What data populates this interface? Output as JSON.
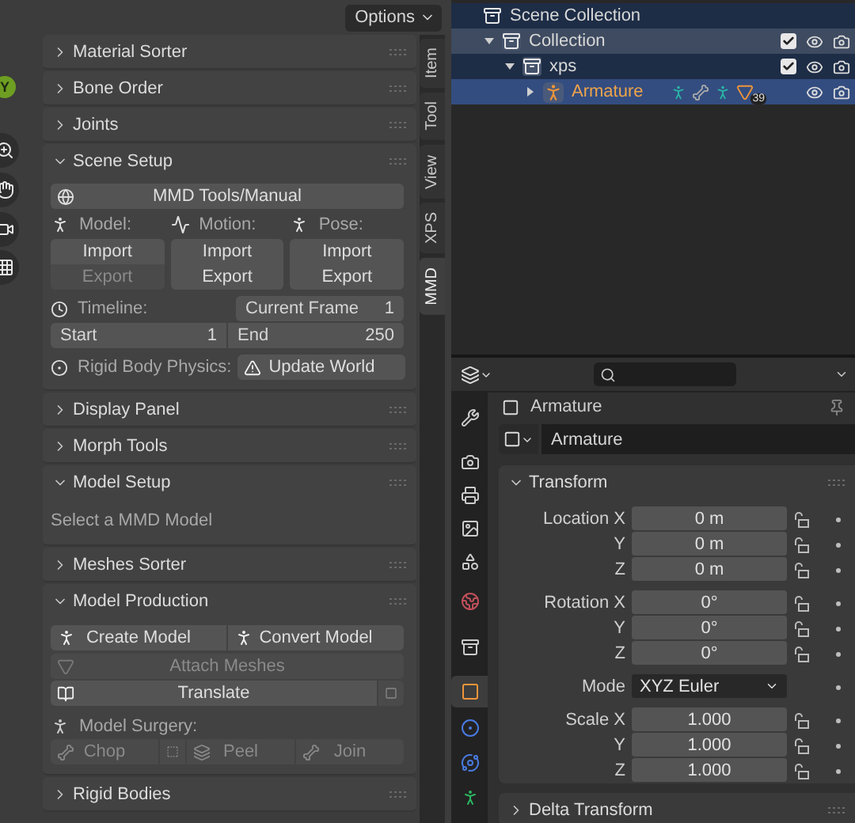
{
  "viewport": {
    "options_button": "Options",
    "gizmo_axis": "Y"
  },
  "sidebar": {
    "tabs": [
      {
        "label": "Item",
        "selected": false
      },
      {
        "label": "Tool",
        "selected": false
      },
      {
        "label": "View",
        "selected": false
      },
      {
        "label": "XPS",
        "selected": false
      },
      {
        "label": "MMD",
        "selected": true
      }
    ],
    "panels": [
      {
        "title": "Material Sorter",
        "expanded": false
      },
      {
        "title": "Bone Order",
        "expanded": false
      },
      {
        "title": "Joints",
        "expanded": false
      },
      {
        "title": "Scene Setup",
        "expanded": true,
        "body": {
          "kind": "scene_setup",
          "manual_button": "MMD Tools/Manual",
          "groups": [
            {
              "kind": "model",
              "label": "Model:",
              "buttons": [
                {
                  "label": "Import",
                  "disabled": false
                },
                {
                  "label": "Export",
                  "disabled": true
                }
              ]
            },
            {
              "kind": "motion",
              "label": "Motion:",
              "buttons": [
                {
                  "label": "Import",
                  "disabled": false
                },
                {
                  "label": "Export",
                  "disabled": false
                }
              ]
            },
            {
              "kind": "pose",
              "label": "Pose:",
              "buttons": [
                {
                  "label": "Import",
                  "disabled": false
                },
                {
                  "label": "Export",
                  "disabled": false
                }
              ]
            }
          ],
          "timeline": {
            "label": "Timeline:",
            "current_frame_label": "Current Frame",
            "current_frame": "1",
            "start_label": "Start",
            "start": "1",
            "end_label": "End",
            "end": "250"
          },
          "rigid_body": {
            "label": "Rigid Body Physics:",
            "button": "Update World"
          }
        }
      },
      {
        "title": "Display Panel",
        "expanded": false
      },
      {
        "title": "Morph Tools",
        "expanded": false
      },
      {
        "title": "Model Setup",
        "expanded": true,
        "body": {
          "kind": "message",
          "text": "Select a MMD Model"
        }
      },
      {
        "title": "Meshes Sorter",
        "expanded": false
      },
      {
        "title": "Model Production",
        "expanded": true,
        "body": {
          "kind": "model_production",
          "create_button": "Create Model",
          "convert_button": "Convert Model",
          "attach_button": {
            "label": "Attach Meshes",
            "disabled": true
          },
          "translate_button": "Translate",
          "surgery_label": "Model Surgery:",
          "surgery_buttons": [
            {
              "kind": "chop",
              "label": "Chop",
              "disabled": true
            },
            {
              "kind": "peel",
              "label": "Peel",
              "disabled": true
            },
            {
              "kind": "join",
              "label": "Join",
              "disabled": true
            }
          ]
        }
      },
      {
        "title": "Rigid Bodies",
        "expanded": false
      }
    ]
  },
  "outliner": {
    "items": [
      {
        "name": "Scene Collection",
        "kind": "scene",
        "selected": false,
        "active": false,
        "children": [
          {
            "name": "Collection",
            "kind": "collection",
            "selected": false,
            "active": true,
            "expanded": true,
            "checked": true,
            "children": [
              {
                "name": "xps",
                "kind": "collection",
                "selected": false,
                "active": false,
                "expanded": true,
                "checked": true,
                "children": [
                  {
                    "name": "Armature",
                    "kind": "object",
                    "selected": true,
                    "active": false,
                    "expanded": false,
                    "badge": "39"
                  }
                ]
              }
            ]
          }
        ]
      }
    ]
  },
  "properties": {
    "tabs": [
      {
        "kind": "tool",
        "selected": false
      },
      {
        "kind": "render",
        "selected": false
      },
      {
        "kind": "output",
        "selected": false
      },
      {
        "kind": "view_layer",
        "selected": false
      },
      {
        "kind": "scene",
        "selected": false
      },
      {
        "kind": "world",
        "selected": false
      },
      {
        "kind": "collection",
        "selected": false
      },
      {
        "kind": "object",
        "selected": true
      },
      {
        "kind": "physics",
        "selected": false
      },
      {
        "kind": "constraints",
        "selected": false
      },
      {
        "kind": "data",
        "selected": false
      }
    ],
    "context": "Armature",
    "datablock": "Armature",
    "panels": [
      {
        "title": "Transform",
        "expanded": true,
        "groups": [
          {
            "rows": [
              {
                "kind": "number",
                "label": "Location X",
                "value": "0 m",
                "locked": false
              },
              {
                "kind": "number",
                "label": "Y",
                "value": "0 m",
                "locked": false
              },
              {
                "kind": "number",
                "label": "Z",
                "value": "0 m",
                "locked": false
              }
            ]
          },
          {
            "rows": [
              {
                "kind": "number",
                "label": "Rotation X",
                "value": "0°",
                "locked": false
              },
              {
                "kind": "number",
                "label": "Y",
                "value": "0°",
                "locked": false
              },
              {
                "kind": "number",
                "label": "Z",
                "value": "0°",
                "locked": false
              }
            ]
          },
          {
            "rows": [
              {
                "kind": "dropdown",
                "label": "Mode",
                "value": "XYZ Euler"
              }
            ]
          },
          {
            "rows": [
              {
                "kind": "number",
                "label": "Scale X",
                "value": "1.000",
                "locked": false
              },
              {
                "kind": "number",
                "label": "Y",
                "value": "1.000",
                "locked": false
              },
              {
                "kind": "number",
                "label": "Z",
                "value": "1.000",
                "locked": false
              }
            ]
          }
        ]
      },
      {
        "title": "Delta Transform",
        "expanded": false
      }
    ]
  }
}
